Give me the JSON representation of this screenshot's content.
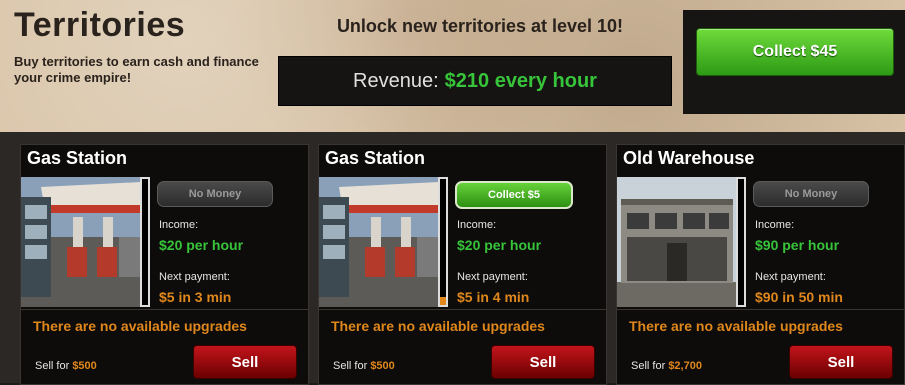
{
  "header": {
    "title": "Territories",
    "subtitle": "Buy territories to earn cash and finance your crime empire!",
    "unlock_text": "Unlock new territories at level 10!",
    "revenue_label": "Revenue:",
    "revenue_value": "$210 every hour",
    "collect_label": "Collect $45"
  },
  "colors": {
    "accent_green": "#37c43a",
    "accent_orange": "#e0871c",
    "sell_red": "#b3121a"
  },
  "cards": [
    {
      "name": "Gas Station",
      "image": "gas-station",
      "status_label": "No Money",
      "status_type": "nomoney",
      "income_label": "Income:",
      "income_value": "$20 per hour",
      "payment_label": "Next payment:",
      "payment_value": "$5 in 3 min",
      "progress": 0.0,
      "upgrades_text": "There are no available upgrades",
      "sell_prefix": "Sell for",
      "sell_price": "$500",
      "sell_label": "Sell"
    },
    {
      "name": "Gas Station",
      "image": "gas-station",
      "status_label": "Collect $5",
      "status_type": "collect",
      "income_label": "Income:",
      "income_value": "$20 per hour",
      "payment_label": "Next payment:",
      "payment_value": "$5 in 4 min",
      "progress": 0.06,
      "upgrades_text": "There are no available upgrades",
      "sell_prefix": "Sell for",
      "sell_price": "$500",
      "sell_label": "Sell"
    },
    {
      "name": "Old Warehouse",
      "image": "warehouse",
      "status_label": "No Money",
      "status_type": "nomoney",
      "income_label": "Income:",
      "income_value": "$90 per hour",
      "payment_label": "Next payment:",
      "payment_value": "$90 in 50 min",
      "progress": 0.0,
      "upgrades_text": "There are no available upgrades",
      "sell_prefix": "Sell for",
      "sell_price": "$2,700",
      "sell_label": "Sell"
    }
  ]
}
